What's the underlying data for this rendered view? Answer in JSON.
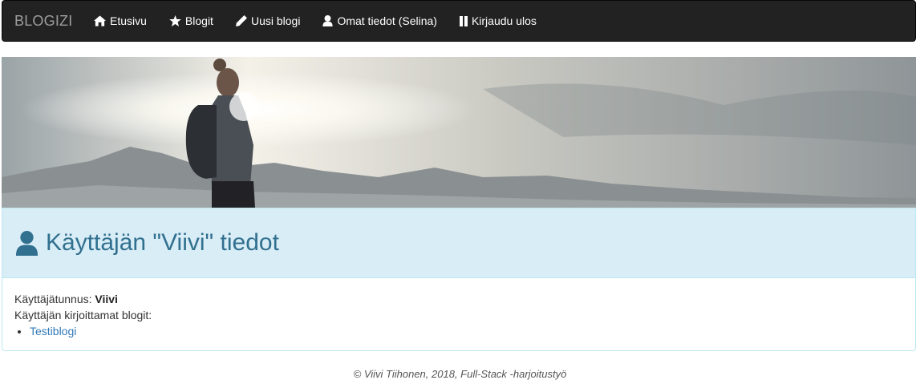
{
  "nav": {
    "brand": "BLOGIZI",
    "items": [
      {
        "label": "Etusivu",
        "icon": "home-icon"
      },
      {
        "label": "Blogit",
        "icon": "star-icon"
      },
      {
        "label": "Uusi blogi",
        "icon": "pencil-icon"
      },
      {
        "label": "Omat tiedot (Selina)",
        "icon": "user-icon"
      },
      {
        "label": "Kirjaudu ulos",
        "icon": "book-icon"
      }
    ]
  },
  "hero": {
    "icon": "hiker-mountain-banner-image"
  },
  "panel": {
    "title": "Käyttäjän \"Viivi\" tiedot",
    "username_label": "Käyttäjätunnus:",
    "username": "Viivi",
    "blogs_label": "Käyttäjän kirjoittamat blogit:",
    "blogs": [
      "Testiblogi"
    ]
  },
  "footer": {
    "text": "© Viivi Tiihonen, 2018, Full-Stack -harjoitustyö"
  },
  "colors": {
    "navbar": "#222222",
    "heading_bg": "#d9edf7",
    "heading_text": "#31708f",
    "link": "#337ab7"
  }
}
